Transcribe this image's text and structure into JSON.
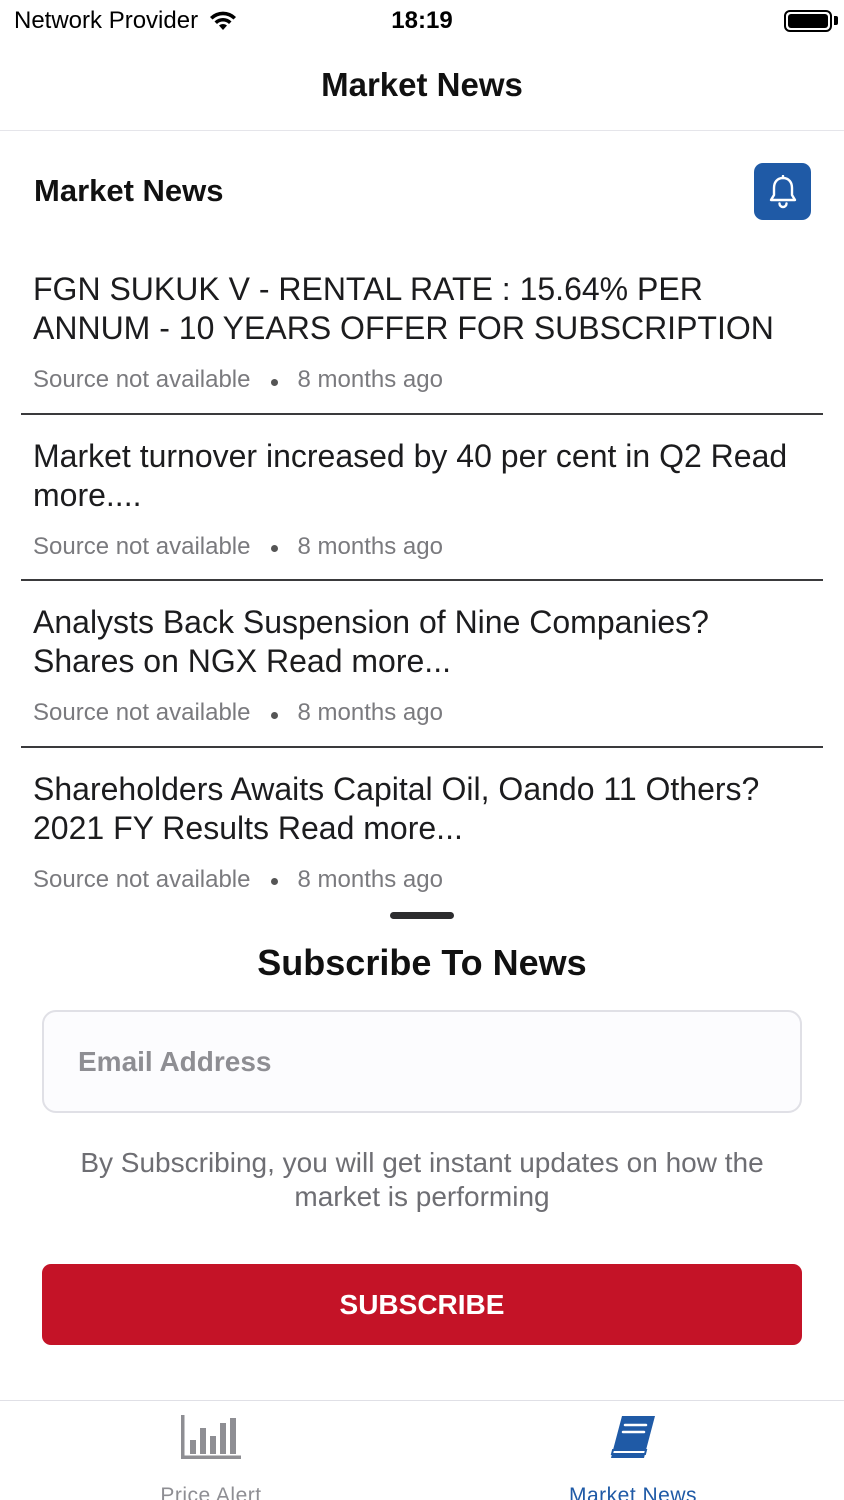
{
  "status_bar": {
    "carrier": "Network Provider",
    "time": "18:19",
    "icons": [
      "wifi-icon",
      "battery-icon"
    ]
  },
  "nav": {
    "title": "Market News"
  },
  "section": {
    "title": "Market News",
    "bell_icon": "bell-icon"
  },
  "news": [
    {
      "headline": "FGN SUKUK V - RENTAL RATE : 15.64% PER ANNUM - 10 YEARS  OFFER FOR SUBSCRIPTION",
      "source": "Source not available",
      "time": "8 months ago"
    },
    {
      "headline": "Market turnover increased by 40 per cent in Q2 Read more....",
      "source": "Source not available",
      "time": "8 months ago"
    },
    {
      "headline": "Analysts Back Suspension of Nine Companies? Shares on NGX Read more...",
      "source": "Source not available",
      "time": "8 months ago"
    },
    {
      "headline": "Shareholders Awaits Capital Oil, Oando 11 Others? 2021 FY Results Read more...",
      "source": "Source not available",
      "time": "8 months ago"
    }
  ],
  "subscribe": {
    "title": "Subscribe To News",
    "email_placeholder": "Email Address",
    "email_value": "",
    "hint": "By Subscribing, you will get instant updates on how the market is performing",
    "button_label": "SUBSCRIBE"
  },
  "tabs": [
    {
      "label": "Price Alert",
      "icon": "bar-chart-icon",
      "active": false
    },
    {
      "label": "Market News",
      "icon": "book-icon",
      "active": true
    }
  ],
  "colors": {
    "accent_blue": "#1f5aa6",
    "subscribe_red": "#c41327",
    "inactive_gray": "#8e8e93"
  }
}
